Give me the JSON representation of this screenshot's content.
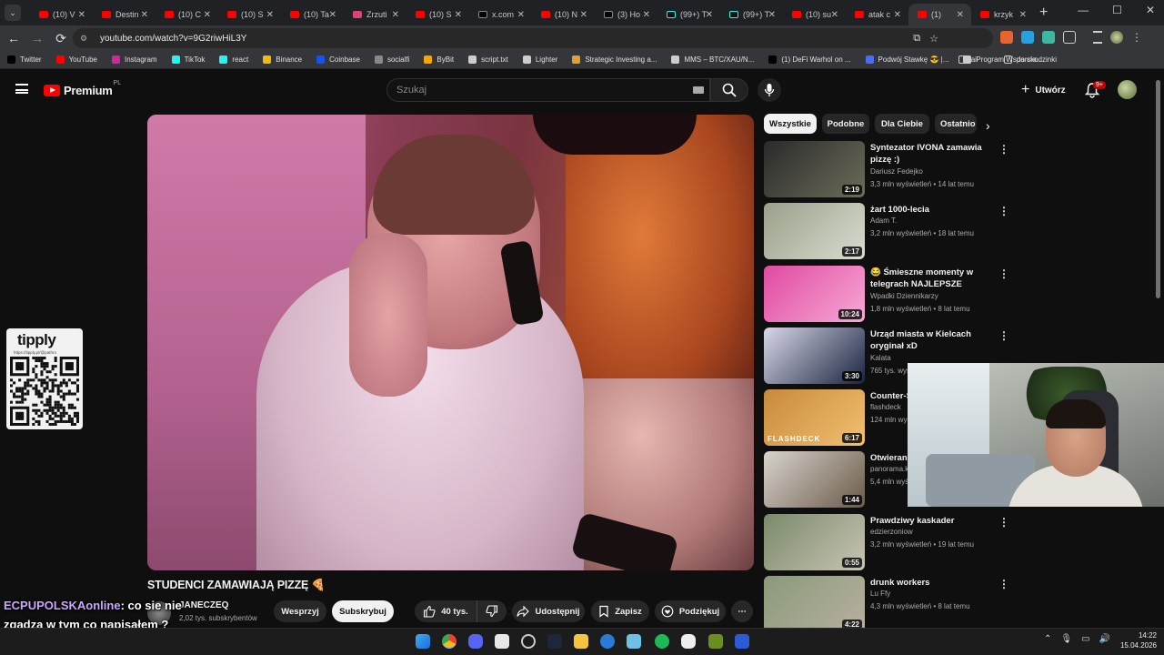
{
  "browser": {
    "tabs": [
      {
        "label": "(10) V",
        "icon": "youtube-icon"
      },
      {
        "label": "Destin",
        "icon": "youtube-icon"
      },
      {
        "label": "(10) C",
        "icon": "youtube-icon"
      },
      {
        "label": "(10) S",
        "icon": "youtube-icon"
      },
      {
        "label": "(10) Ta",
        "icon": "youtube-icon"
      },
      {
        "label": "Zrzuti",
        "icon": "pink-icon"
      },
      {
        "label": "(10) S",
        "icon": "youtube-icon"
      },
      {
        "label": "x.com",
        "icon": "x-icon"
      },
      {
        "label": "(10) N",
        "icon": "youtube-icon"
      },
      {
        "label": "(3) Ho",
        "icon": "x-icon"
      },
      {
        "label": "(99+) T",
        "icon": "tiktok-icon"
      },
      {
        "label": "(99+) T",
        "icon": "tiktok-icon"
      },
      {
        "label": "(10) su",
        "icon": "youtube-icon"
      },
      {
        "label": "atak c",
        "icon": "youtube-icon"
      },
      {
        "label": "(1)",
        "icon": "youtube-icon"
      },
      {
        "label": "krzyk",
        "icon": "youtube-icon"
      }
    ],
    "url": "youtube.com/watch?v=9G2riwHiL3Y",
    "bookmarks": [
      {
        "label": "Twitter",
        "color": "#000000"
      },
      {
        "label": "YouTube",
        "color": "#ff0000"
      },
      {
        "label": "Instagram",
        "color": "#d6249f"
      },
      {
        "label": "TikTok",
        "color": "#25f4ee"
      },
      {
        "label": "react",
        "color": "#25f4ee"
      },
      {
        "label": "Binance",
        "color": "#f0b90b"
      },
      {
        "label": "Coinbase",
        "color": "#1652f0"
      },
      {
        "label": "socialfi",
        "color": "#888888"
      },
      {
        "label": "ByBit",
        "color": "#f7a600"
      },
      {
        "label": "script.txt",
        "color": "#cccccc"
      },
      {
        "label": "Lighter",
        "color": "#cccccc"
      },
      {
        "label": "Strategic Investing a...",
        "color": "#e0a030"
      },
      {
        "label": "MMS – BTC/XAU/N...",
        "color": "#cccccc"
      },
      {
        "label": "(1) DeFi Warhol on ...",
        "color": "#000000"
      },
      {
        "label": "Podwój Stawkę 😎 |...",
        "color": "#4a6cf7"
      },
      {
        "label": "Program Wsparcia...",
        "color": "#cccccc"
      }
    ],
    "bookmark_folders": [
      "ai",
      "do skodzinki"
    ]
  },
  "youtube": {
    "logo_word": "Premium",
    "logo_country": "PL",
    "search_placeholder": "Szukaj",
    "create_label": "Utwórz",
    "notif_badge": "9+",
    "video": {
      "title": "STUDENCI ZAMAWIAJĄ PIZZĘ 🍕",
      "channel": "JANECZEQ",
      "subscribers": "2,02 tys. subskrybentów",
      "support_label": "Wesprzyj",
      "subscribe_label": "Subskrybuj",
      "likes": "40 tys.",
      "share_label": "Udostępnij",
      "save_label": "Zapisz",
      "thanks_label": "Podziękuj"
    },
    "chips": [
      "Wszystkie",
      "Podobne",
      "Dla Ciebie",
      "Ostatnio"
    ],
    "recommendations": [
      {
        "title": "Syntezator IVONA zamawia pizzę :)",
        "channel": "Dariusz Fedejko",
        "meta": "3,3 mln wyświetleń • 14 lat temu",
        "duration": "2:19",
        "c1": "#2a2a2a",
        "c2": "#6c6c5a"
      },
      {
        "title": "żart 1000-lecia",
        "channel": "Adam T.",
        "meta": "3,2 mln wyświetleń • 18 lat temu",
        "duration": "2:17",
        "c1": "#9aa08a",
        "c2": "#d8ddd0"
      },
      {
        "title": "😂 Śmieszne momenty w telegrach NAJLEPSZE WPADK...",
        "channel": "Wpadki Dziennikarzy",
        "meta": "1,8 mln wyświetleń • 8 lat temu",
        "duration": "10:24",
        "c1": "#e04aa0",
        "c2": "#f7a8d6"
      },
      {
        "title": "Urząd miasta w Kielcach oryginał xD",
        "channel": "Kalata",
        "meta": "765 tys. wyświetleń",
        "duration": "3:30",
        "c1": "#d8d8e8",
        "c2": "#1a2440"
      },
      {
        "title": "Counter-S",
        "channel": "flashdeck",
        "meta": "124 mln wyświetleń",
        "duration": "6:17",
        "c1": "#c88a3a",
        "c2": "#f0c070",
        "tag": "FLASHDECK"
      },
      {
        "title": "Otwieranie",
        "channel": "panorama.k",
        "meta": "5,4 mln wyświetleń",
        "duration": "1:44",
        "c1": "#d8d4cc",
        "c2": "#6a5a4a"
      },
      {
        "title": "Prawdziwy kaskader",
        "channel": "edzierzoniow",
        "meta": "3,2 mln wyświetleń • 19 lat temu",
        "duration": "0:55",
        "c1": "#7a8a6a",
        "c2": "#c8c4b4"
      },
      {
        "title": "drunk workers",
        "channel": "Lu Ffy",
        "meta": "4,3 mln wyświetleń • 8 lat temu",
        "duration": "4:22",
        "c1": "#8a9a7a",
        "c2": "#b8b0a0"
      }
    ]
  },
  "overlay": {
    "tipply_logo": "tipply",
    "tipply_url": "https://tipply.pl/@pathro",
    "chat_user": "ECPUPOLSKAonline",
    "chat_message": ": co sie nie zgadza w tym co napisałem ?"
  },
  "taskbar": {
    "time": "14:22",
    "date": "15.04.2026"
  }
}
